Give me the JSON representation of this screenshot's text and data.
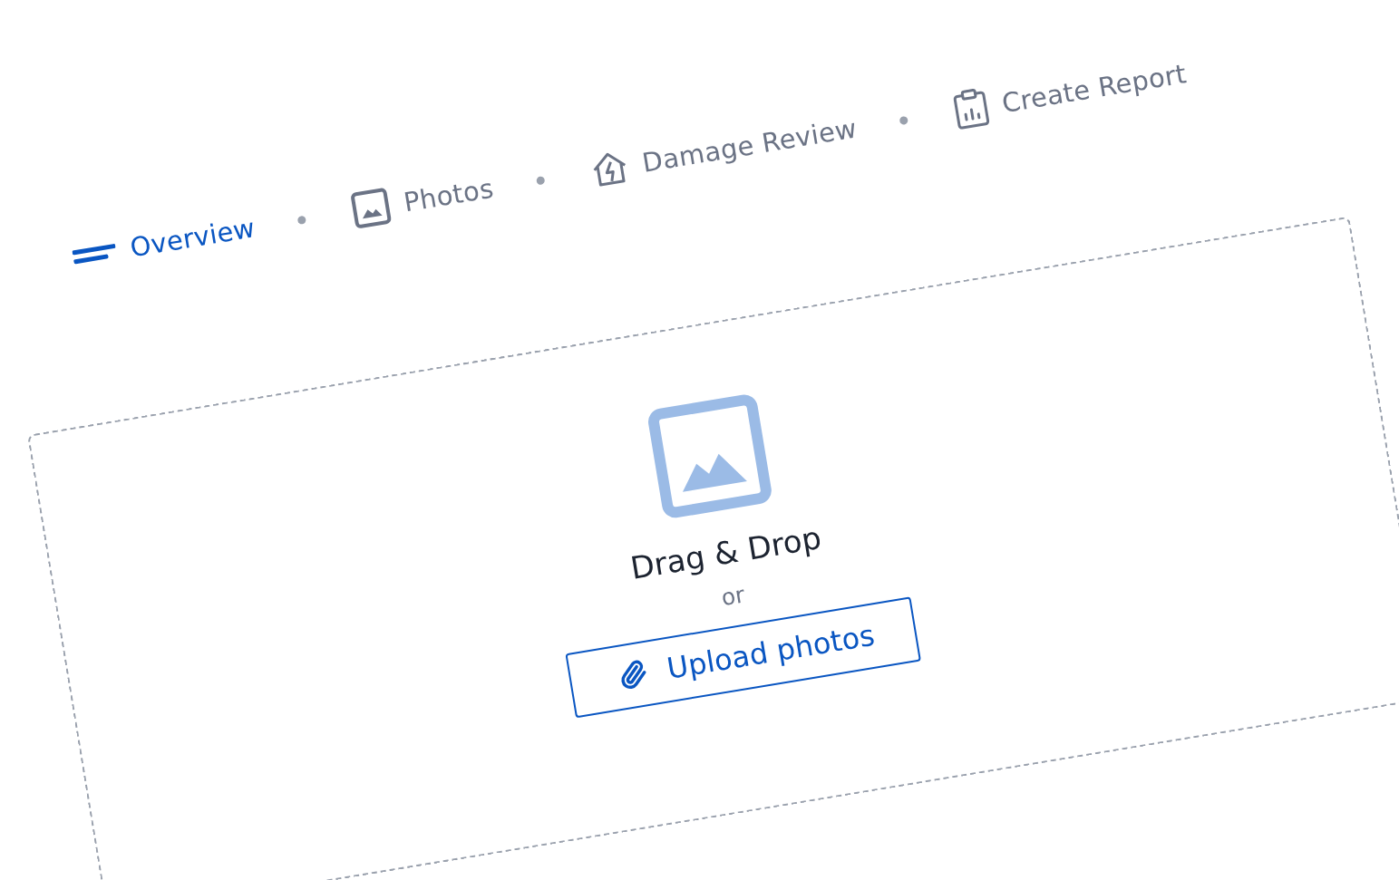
{
  "tabs": [
    {
      "label": "Overview",
      "selected": true
    },
    {
      "label": "Photos",
      "selected": false
    },
    {
      "label": "Damage Review",
      "selected": false
    },
    {
      "label": "Create Report",
      "selected": false
    }
  ],
  "dropzone": {
    "title": "Drag & Drop",
    "separator": "or",
    "button": "Upload photos"
  }
}
